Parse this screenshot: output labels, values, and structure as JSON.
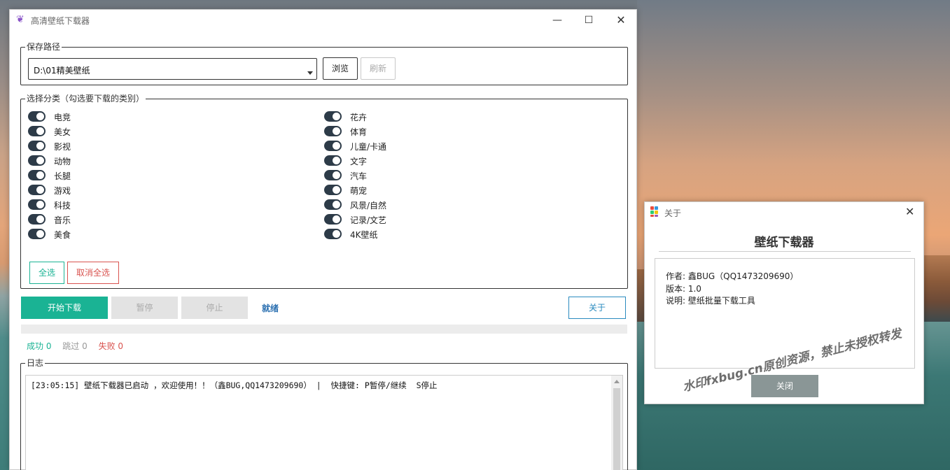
{
  "main_window": {
    "title": "高清壁纸下载器",
    "controls": {
      "minimize": "—",
      "maximize": "☐",
      "close": "✕"
    }
  },
  "save_path": {
    "legend": "保存路径",
    "value": "D:\\01精美壁纸",
    "browse_label": "浏览",
    "refresh_label": "刷新"
  },
  "categories": {
    "legend": "选择分类（勾选要下载的类别）",
    "left": [
      {
        "label": "电竞",
        "on": true
      },
      {
        "label": "美女",
        "on": true
      },
      {
        "label": "影视",
        "on": true
      },
      {
        "label": "动物",
        "on": true
      },
      {
        "label": "长腿",
        "on": true
      },
      {
        "label": "游戏",
        "on": true
      },
      {
        "label": "科技",
        "on": true
      },
      {
        "label": "音乐",
        "on": true
      },
      {
        "label": "美食",
        "on": true
      }
    ],
    "right": [
      {
        "label": "花卉",
        "on": true
      },
      {
        "label": "体育",
        "on": true
      },
      {
        "label": "儿童/卡通",
        "on": true
      },
      {
        "label": "文字",
        "on": true
      },
      {
        "label": "汽车",
        "on": true
      },
      {
        "label": "萌宠",
        "on": true
      },
      {
        "label": "风景/自然",
        "on": true
      },
      {
        "label": "记录/文艺",
        "on": true
      },
      {
        "label": "4K壁纸",
        "on": true
      }
    ],
    "select_all_label": "全选",
    "deselect_all_label": "取消全选"
  },
  "actions": {
    "start_label": "开始下载",
    "pause_label": "暂停",
    "stop_label": "停止",
    "status": "就绪",
    "about_label": "关于"
  },
  "progress": {
    "fraction": 0
  },
  "stats": {
    "success": "成功 0",
    "skipped": "跳过 0",
    "failed": "失败 0"
  },
  "log": {
    "legend": "日志",
    "line": "[23:05:15] 壁纸下载器已启动 ，欢迎使用！！（鑫BUG,QQ1473209690） |  快捷键: P暂停/继续  S停止"
  },
  "about_dialog": {
    "title": "关于",
    "close": "✕",
    "heading": "壁纸下载器",
    "author": "作者: 鑫BUG（QQ1473209690）",
    "version": "版本: 1.0",
    "description": "说明: 壁纸批量下载工具",
    "ok_label": "关闭"
  },
  "watermark": "水印fxbug.cn原创资源，禁止未授权转发",
  "colors": {
    "accent_green": "#1ab394",
    "danger_red": "#d9534f",
    "toggle_dark": "#2d3b48",
    "status_blue": "#2a6fb0"
  }
}
